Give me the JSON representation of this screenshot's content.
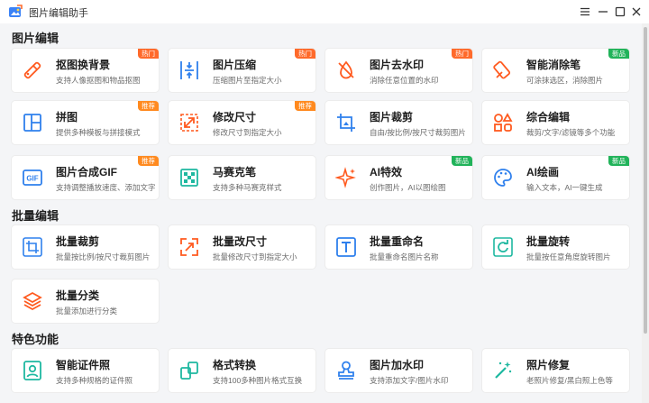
{
  "window": {
    "title": "图片编辑助手",
    "controls": {
      "menu": "☰",
      "minimize": "—",
      "maximize": "☐",
      "close": "✕"
    }
  },
  "sections": {
    "edit": "图片编辑",
    "batch": "批量编辑",
    "special": "特色功能"
  },
  "cards": {
    "matting": {
      "name": "抠图换背景",
      "desc": "支持人像抠图和物品抠图",
      "badge": "热门",
      "icon": "magic-wand-icon"
    },
    "compress": {
      "name": "图片压缩",
      "desc": "压缩图片至指定大小",
      "badge": "热门",
      "icon": "compress-icon"
    },
    "watermark_remove": {
      "name": "图片去水印",
      "desc": "消除任意位置的水印",
      "badge": "热门",
      "icon": "watermark-remove-icon"
    },
    "eraser": {
      "name": "智能消除笔",
      "desc": "可涂抹选区，消除图片",
      "badge": "新品",
      "icon": "eraser-icon"
    },
    "collage": {
      "name": "拼图",
      "desc": "提供多种模板与拼接模式",
      "badge": "推荐",
      "icon": "collage-icon"
    },
    "resize": {
      "name": "修改尺寸",
      "desc": "修改尺寸到指定大小",
      "badge": "推荐",
      "icon": "resize-icon"
    },
    "crop": {
      "name": "图片裁剪",
      "desc": "自由/按比例/按尺寸裁剪图片",
      "icon": "crop-icon"
    },
    "combo": {
      "name": "综合编辑",
      "desc": "裁剪/文字/滤镜等多个功能",
      "icon": "grid-icon"
    },
    "gif": {
      "name": "图片合成GIF",
      "desc": "支持调整播放速度、添加文字",
      "badge": "推荐",
      "icon": "gif-icon"
    },
    "mosaic": {
      "name": "马赛克笔",
      "desc": "支持多种马赛克样式",
      "icon": "mosaic-icon"
    },
    "ai_effect": {
      "name": "AI特效",
      "desc": "创作图片，AI以图绘图",
      "badge": "新品",
      "icon": "sparkle-icon"
    },
    "ai_paint": {
      "name": "AI绘画",
      "desc": "输入文本，AI一键生成",
      "badge": "新品",
      "icon": "palette-icon"
    },
    "batch_crop": {
      "name": "批量裁剪",
      "desc": "批量按比例/按尺寸裁剪图片",
      "icon": "batch-crop-icon"
    },
    "batch_resize": {
      "name": "批量改尺寸",
      "desc": "批量修改尺寸到指定大小",
      "icon": "batch-resize-icon"
    },
    "batch_rename": {
      "name": "批量重命名",
      "desc": "批量重命名图片名称",
      "icon": "rename-icon"
    },
    "batch_rotate": {
      "name": "批量旋转",
      "desc": "批量按任意角度旋转图片",
      "icon": "rotate-icon"
    },
    "batch_classify": {
      "name": "批量分类",
      "desc": "批量添加进行分类",
      "icon": "layers-icon"
    },
    "id_photo": {
      "name": "智能证件照",
      "desc": "支持多种规格的证件照",
      "icon": "id-photo-icon"
    },
    "convert": {
      "name": "格式转换",
      "desc": "支持100多种图片格式互换",
      "icon": "convert-icon"
    },
    "add_watermark": {
      "name": "图片加水印",
      "desc": "支持添加文字/图片水印",
      "icon": "stamp-icon"
    },
    "repair": {
      "name": "照片修复",
      "desc": "老照片修复/黑白照上色等",
      "icon": "magic-stick-icon"
    }
  },
  "colors": {
    "accent_blue": "#2f80ed",
    "accent_orange": "#ff5a1f",
    "hot_badge": "#ff6a2b",
    "rec_badge": "#ff8a1f",
    "new_badge": "#21b35a"
  }
}
